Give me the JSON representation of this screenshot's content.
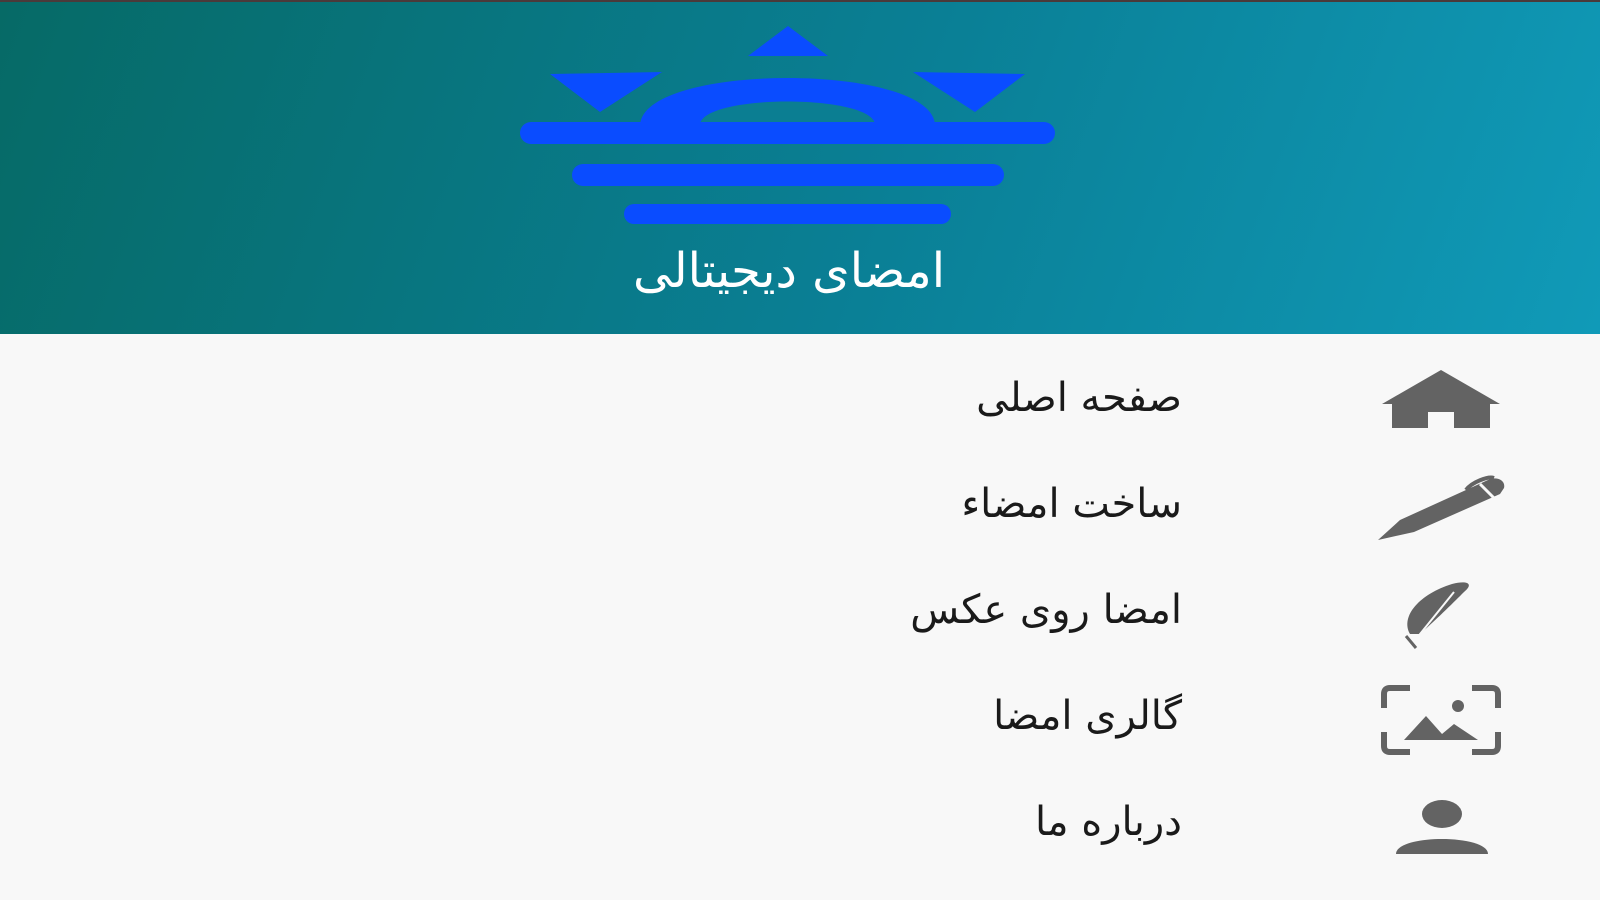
{
  "header": {
    "title": "امضای دیجیتالی",
    "logo_icon": "signature-app-logo-icon",
    "gradient_start": "#066a66",
    "gradient_end": "#109ab8",
    "logo_color": "#0a4cff"
  },
  "menu": {
    "items": [
      {
        "label": "صفحه اصلی",
        "icon": "home-icon"
      },
      {
        "label": "ساخت امضاء",
        "icon": "pen-icon"
      },
      {
        "label": "امضا روی عکس",
        "icon": "feather-icon"
      },
      {
        "label": "گالری امضا",
        "icon": "gallery-icon"
      },
      {
        "label": "درباره ما",
        "icon": "person-icon"
      }
    ],
    "icon_color": "#636363",
    "text_color": "#1a1a1a"
  }
}
